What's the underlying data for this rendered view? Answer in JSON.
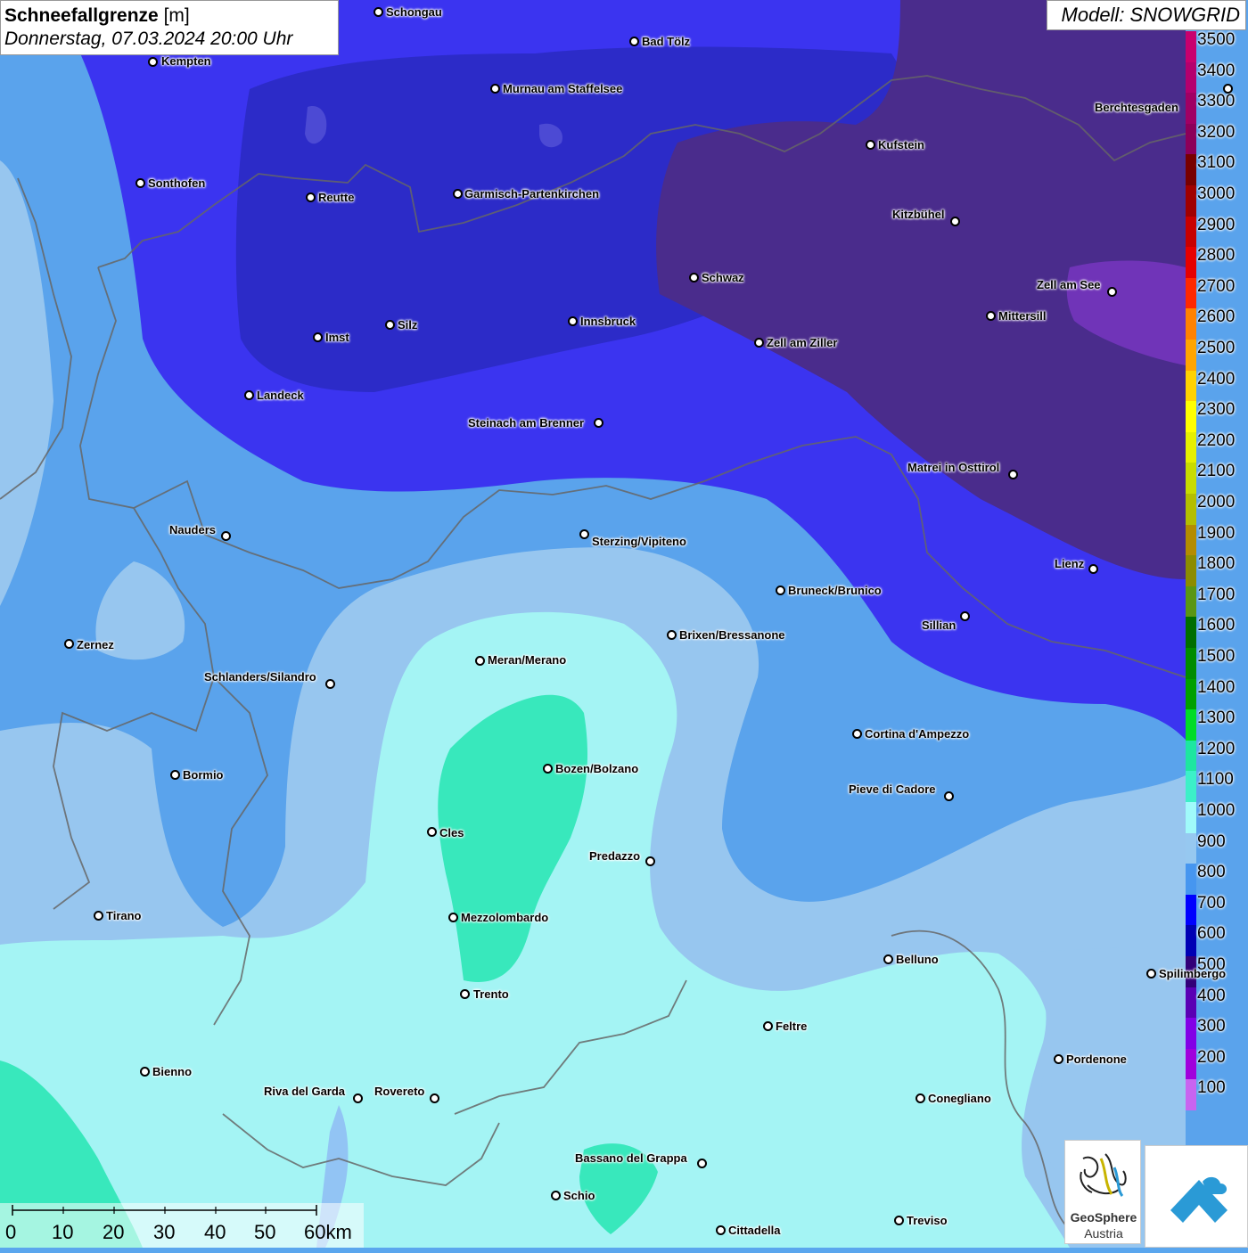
{
  "title": {
    "parameter": "Schneefallgrenze",
    "unit": "[m]",
    "datetime": "Donnerstag, 07.03.2024 20:00 Uhr"
  },
  "model_label": "Modell: SNOWGRID",
  "legend": {
    "levels": [
      {
        "label": "3500",
        "color": "#c8006e"
      },
      {
        "label": "3400",
        "color": "#b4006e"
      },
      {
        "label": "3300",
        "color": "#a00064"
      },
      {
        "label": "3200",
        "color": "#8c005a"
      },
      {
        "label": "3100",
        "color": "#780000"
      },
      {
        "label": "3000",
        "color": "#a00000"
      },
      {
        "label": "2900",
        "color": "#c80000"
      },
      {
        "label": "2800",
        "color": "#e60000"
      },
      {
        "label": "2700",
        "color": "#ff2800"
      },
      {
        "label": "2600",
        "color": "#ff8200"
      },
      {
        "label": "2500",
        "color": "#ffa500"
      },
      {
        "label": "2400",
        "color": "#ffd200"
      },
      {
        "label": "2300",
        "color": "#ffff00"
      },
      {
        "label": "2200",
        "color": "#e6f000"
      },
      {
        "label": "2100",
        "color": "#c8dc00"
      },
      {
        "label": "2000",
        "color": "#b4be00"
      },
      {
        "label": "1900",
        "color": "#b48c00"
      },
      {
        "label": "1800",
        "color": "#8c8c00"
      },
      {
        "label": "1700",
        "color": "#5a9614"
      },
      {
        "label": "1600",
        "color": "#006e00"
      },
      {
        "label": "1500",
        "color": "#008c00"
      },
      {
        "label": "1400",
        "color": "#00a000"
      },
      {
        "label": "1300",
        "color": "#00dc28"
      },
      {
        "label": "1200",
        "color": "#1ee6a0"
      },
      {
        "label": "1100",
        "color": "#3cf0c8"
      },
      {
        "label": "1000",
        "color": "#a0fafa"
      },
      {
        "label": "900",
        "color": "#96c8f0"
      },
      {
        "label": "800",
        "color": "#4696f0"
      },
      {
        "label": "700",
        "color": "#0000ff"
      },
      {
        "label": "600",
        "color": "#0000b4"
      },
      {
        "label": "500",
        "color": "#320078"
      },
      {
        "label": "400",
        "color": "#5a00b4"
      },
      {
        "label": "300",
        "color": "#8200e6"
      },
      {
        "label": "200",
        "color": "#a000dc"
      },
      {
        "label": "100",
        "color": "#c864f0"
      }
    ]
  },
  "cities": [
    {
      "name": "Schongau"
    },
    {
      "name": "Kempten"
    },
    {
      "name": "Bad Tölz"
    },
    {
      "name": "Murnau am Staffelsee"
    },
    {
      "name": "Berchtesgaden"
    },
    {
      "name": "Kufstein"
    },
    {
      "name": "Sonthofen"
    },
    {
      "name": "Reutte"
    },
    {
      "name": "Garmisch-Partenkirchen"
    },
    {
      "name": "Kitzbühel"
    },
    {
      "name": "Schwaz"
    },
    {
      "name": "Zell am See"
    },
    {
      "name": "Innsbruck"
    },
    {
      "name": "Silz"
    },
    {
      "name": "Imst"
    },
    {
      "name": "Mittersill"
    },
    {
      "name": "Zell am Ziller"
    },
    {
      "name": "Landeck"
    },
    {
      "name": "Steinach am Brenner"
    },
    {
      "name": "Matrei in Osttirol"
    },
    {
      "name": "Nauders"
    },
    {
      "name": "Sterzing/Vipiteno"
    },
    {
      "name": "Lienz"
    },
    {
      "name": "Bruneck/Brunico"
    },
    {
      "name": "Sillian"
    },
    {
      "name": "Zernez"
    },
    {
      "name": "Brixen/Bressanone"
    },
    {
      "name": "Meran/Merano"
    },
    {
      "name": "Schlanders/Silandro"
    },
    {
      "name": "Cortina d'Ampezzo"
    },
    {
      "name": "Bormio"
    },
    {
      "name": "Bozen/Bolzano"
    },
    {
      "name": "Pieve di Cadore"
    },
    {
      "name": "Cles"
    },
    {
      "name": "Predazzo"
    },
    {
      "name": "Tirano"
    },
    {
      "name": "Mezzolombardo"
    },
    {
      "name": "Belluno"
    },
    {
      "name": "Spilimbergo"
    },
    {
      "name": "Trento"
    },
    {
      "name": "Feltre"
    },
    {
      "name": "Pordenone"
    },
    {
      "name": "Bienno"
    },
    {
      "name": "Riva del Garda"
    },
    {
      "name": "Rovereto"
    },
    {
      "name": "Conegliano"
    },
    {
      "name": "Bassano del Grappa"
    },
    {
      "name": "Schio"
    },
    {
      "name": "Treviso"
    },
    {
      "name": "Cittadella"
    }
  ],
  "scalebar": {
    "labels": [
      "0",
      "10",
      "20",
      "30",
      "40",
      "50",
      "60km"
    ]
  },
  "logos": {
    "geosphere_name": "GeoSphere",
    "geosphere_sub": "Austria"
  }
}
